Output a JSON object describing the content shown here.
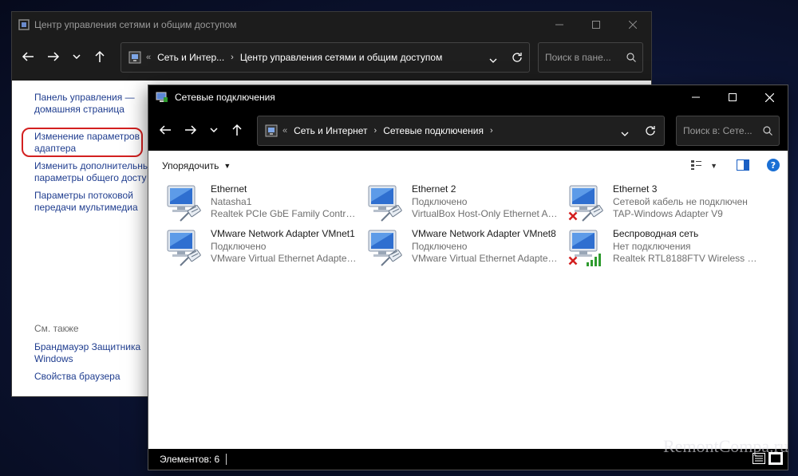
{
  "control_panel": {
    "title": "Центр управления сетями и общим доступом",
    "address": {
      "overflow": "«",
      "crumbs": [
        "Сеть и Интер...",
        "Центр управления сетями и общим доступом"
      ]
    },
    "search_placeholder": "Поиск в пане...",
    "links": {
      "home_line1": "Панель управления —",
      "home_line2": "домашняя страница",
      "adapter_line1": "Изменение параметров",
      "adapter_line2": "адаптера",
      "sharing_line1": "Изменить дополнительные",
      "sharing_line2": "параметры общего досту",
      "media_line1": "Параметры потоковой",
      "media_line2": "передачи мультимедиа"
    },
    "see_also": {
      "heading": "См. также",
      "firewall_line1": "Брандмауэр Защитника",
      "firewall_line2": "Windows",
      "browser": "Свойства браузера"
    }
  },
  "network_connections": {
    "title": "Сетевые подключения",
    "address": {
      "overflow": "«",
      "crumbs": [
        "Сеть и Интернет",
        "Сетевые подключения"
      ]
    },
    "search_placeholder": "Поиск в: Сете...",
    "toolbar": {
      "organize_label": "Упорядочить"
    },
    "items": [
      {
        "name": "Ethernet",
        "status": "Natasha1",
        "device": "Realtek PCIe GbE Family Controller",
        "type": "wired",
        "disconnected": false
      },
      {
        "name": "Ethernet 2",
        "status": "Подключено",
        "device": "VirtualBox Host-Only Ethernet Ad...",
        "type": "wired",
        "disconnected": false
      },
      {
        "name": "Ethernet 3",
        "status": "Сетевой кабель не подключен",
        "device": "TAP-Windows Adapter V9",
        "type": "wired",
        "disconnected": true
      },
      {
        "name": "VMware Network Adapter VMnet1",
        "status": "Подключено",
        "device": "VMware Virtual Ethernet Adapter ...",
        "type": "wired",
        "disconnected": false
      },
      {
        "name": "VMware Network Adapter VMnet8",
        "status": "Подключено",
        "device": "VMware Virtual Ethernet Adapter ...",
        "type": "wired",
        "disconnected": false
      },
      {
        "name": "Беспроводная сеть",
        "status": "Нет подключения",
        "device": "Realtek RTL8188FTV Wireless LAN ...",
        "type": "wireless",
        "disconnected": true
      }
    ],
    "status_bar": {
      "count_text": "Элементов: 6"
    }
  },
  "watermark": "RemontCompa.ru",
  "colors": {
    "link": "#1f3d8f",
    "highlight": "#d32020",
    "error": "#d32020",
    "signal": "#2e9b2e"
  }
}
